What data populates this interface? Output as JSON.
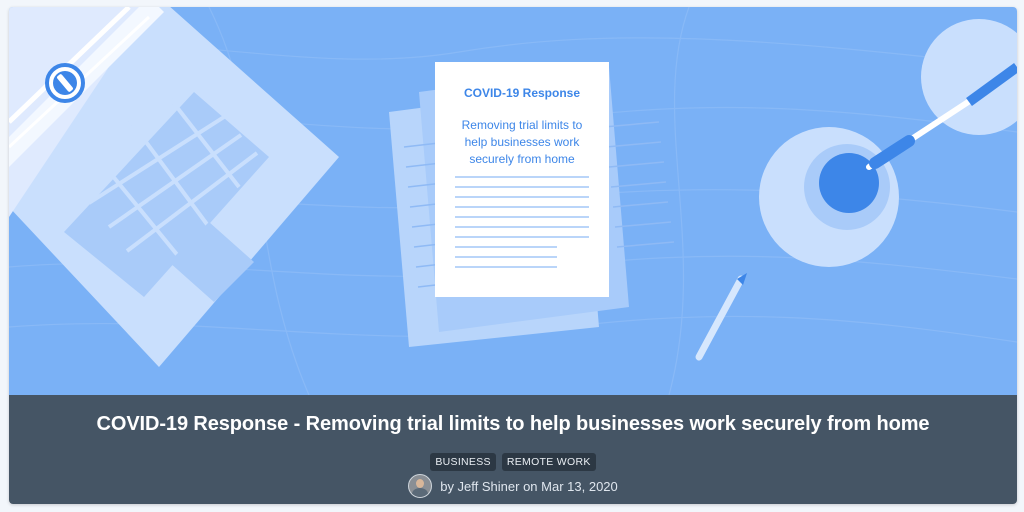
{
  "illustration": {
    "document_heading": "COVID-19 Response",
    "document_lines": [
      "Removing trial limits to",
      "help businesses work",
      "securely from home"
    ],
    "colors": {
      "background": "#7ab1f6",
      "accent": "#3d86e8",
      "paper": "#ffffff"
    }
  },
  "post": {
    "title": "COVID-19 Response - Removing trial limits to help businesses work securely from home",
    "tags": [
      "BUSINESS",
      "REMOTE WORK"
    ],
    "byline": "by Jeff Shiner on Mar 13, 2020"
  },
  "icons": {
    "avatar": "author-avatar",
    "logo": "1password-logo-icon"
  }
}
